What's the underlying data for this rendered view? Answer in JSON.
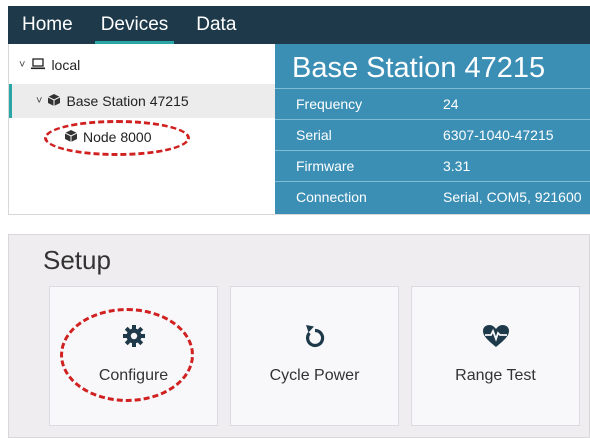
{
  "nav": {
    "tabs": [
      "Home",
      "Devices",
      "Data"
    ],
    "active": "Devices"
  },
  "tree": {
    "root": {
      "label": "local",
      "icon": "laptop-icon",
      "chevron": "˅"
    },
    "base": {
      "label": "Base Station 47215",
      "icon": "cube-icon",
      "chevron": "˅"
    },
    "node": {
      "label": "Node 8000",
      "icon": "cube-icon"
    }
  },
  "detail": {
    "title": "Base Station 47215",
    "rows": [
      {
        "key": "Frequency",
        "value": "24"
      },
      {
        "key": "Serial",
        "value": "6307-1040-47215"
      },
      {
        "key": "Firmware",
        "value": "3.31"
      },
      {
        "key": "Connection",
        "value": "Serial, COM5, 921600"
      }
    ]
  },
  "setup": {
    "title": "Setup",
    "cards": [
      {
        "label": "Configure",
        "icon": "gear-icon"
      },
      {
        "label": "Cycle Power",
        "icon": "rotate-icon"
      },
      {
        "label": "Range Test",
        "icon": "heartbeat-icon"
      }
    ]
  },
  "colors": {
    "nav_bg": "#1e3a4a",
    "accent": "#2aa6a6",
    "detail_bg": "#3b8fb5",
    "annotation": "#d02020"
  }
}
